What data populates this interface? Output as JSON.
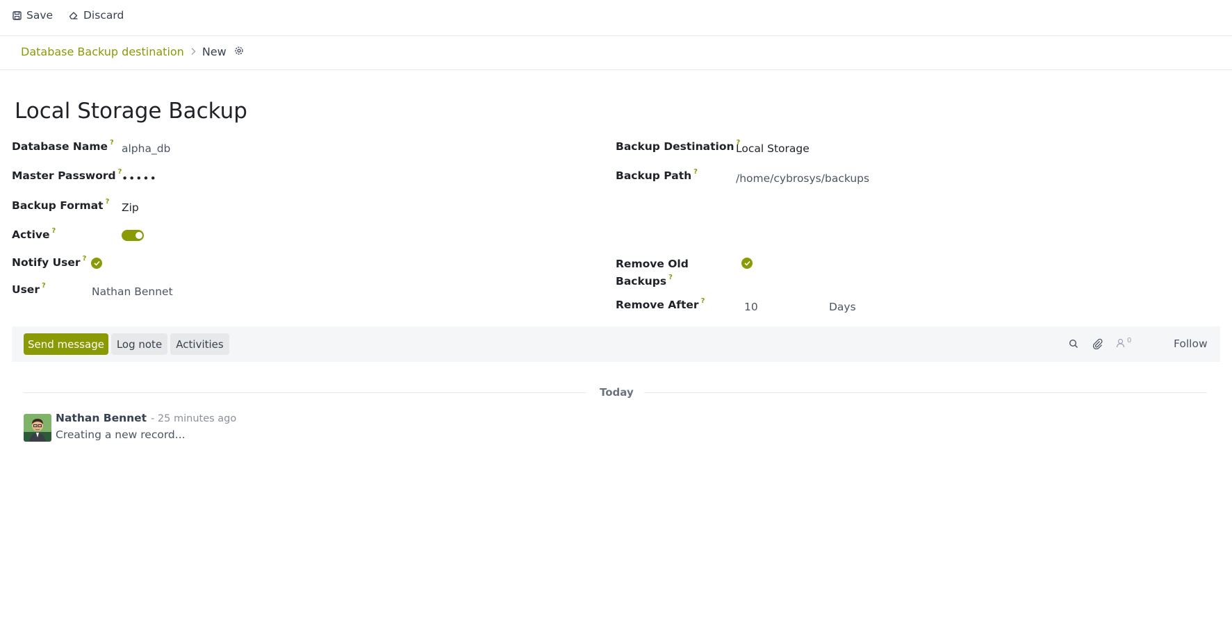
{
  "toolbar": {
    "save_label": "Save",
    "discard_label": "Discard"
  },
  "breadcrumb": {
    "parent": "Database Backup destination",
    "current": "New"
  },
  "record": {
    "title": "Local Storage Backup"
  },
  "fields": {
    "database_name": {
      "label": "Database Name",
      "help": "?",
      "value": "alpha_db"
    },
    "master_password": {
      "label": "Master Password",
      "help": "?",
      "value": "•••••"
    },
    "backup_format": {
      "label": "Backup Format",
      "help": "?",
      "value": "Zip"
    },
    "active": {
      "label": "Active",
      "help": "?",
      "value": true
    },
    "notify_user": {
      "label": "Notify User",
      "help": "?",
      "value": true
    },
    "user": {
      "label": "User",
      "help": "?",
      "value": "Nathan Bennet"
    },
    "backup_destination": {
      "label": "Backup Destination",
      "help": "?",
      "value": "Local Storage"
    },
    "backup_path": {
      "label": "Backup Path",
      "help": "?",
      "value": "/home/cybrosys/backups"
    },
    "remove_old_backups": {
      "label_line1": "Remove Old",
      "label_line2": "Backups",
      "help": "?",
      "value": true
    },
    "remove_after": {
      "label": "Remove After",
      "help": "?",
      "value": "10",
      "unit": "Days"
    }
  },
  "chatter": {
    "send_message_label": "Send message",
    "log_note_label": "Log note",
    "activities_label": "Activities",
    "followers_count": "0",
    "follow_label": "Follow",
    "date_separator": "Today",
    "messages": [
      {
        "author": "Nathan Bennet",
        "time": "- 25 minutes ago",
        "body": "Creating a new record..."
      }
    ]
  },
  "colors": {
    "accent": "#8a9a05",
    "text": "#1f2328",
    "muted": "#4b5563"
  }
}
